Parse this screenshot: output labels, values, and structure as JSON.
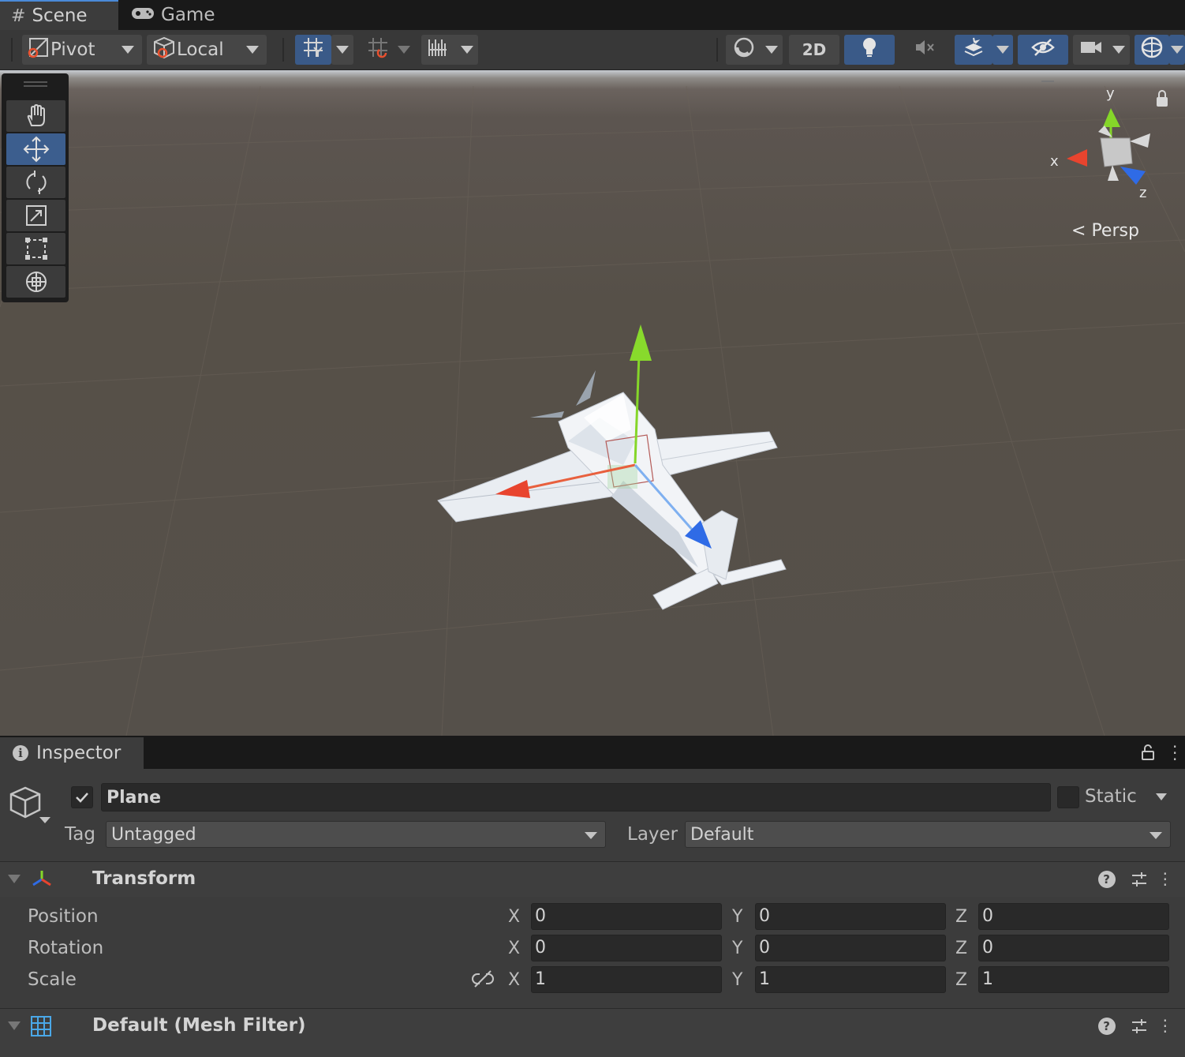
{
  "tabs": {
    "scene": "Scene",
    "game": "Game"
  },
  "toolbar": {
    "pivot_label": "Pivot",
    "local_label": "Local",
    "mode_2d_label": "2D",
    "icons": [
      "grid-snap-icon",
      "increment-snap-icon",
      "ruler-icon",
      "shading-mode-icon",
      "lighting-icon",
      "audio-mute-icon",
      "effects-icon",
      "hidden-objects-icon",
      "camera-icon",
      "gizmos-icon"
    ]
  },
  "scene": {
    "persp_label": "Persp",
    "gizmo_axes": {
      "x": "x",
      "y": "y",
      "z": "z"
    },
    "tools": [
      "hand-tool",
      "move-tool",
      "rotate-tool",
      "scale-tool",
      "rect-tool",
      "transform-tool"
    ],
    "active_tool": "move-tool"
  },
  "inspector": {
    "tab_label": "Inspector",
    "object_name": "Plane",
    "active": true,
    "static_label": "Static",
    "tag_label": "Tag",
    "tag_value": "Untagged",
    "layer_label": "Layer",
    "layer_value": "Default",
    "transform": {
      "title": "Transform",
      "position": {
        "label": "Position",
        "x": "0",
        "y": "0",
        "z": "0"
      },
      "rotation": {
        "label": "Rotation",
        "x": "0",
        "y": "0",
        "z": "0"
      },
      "scale": {
        "label": "Scale",
        "x": "1",
        "y": "1",
        "z": "1"
      },
      "axis_labels": {
        "x": "X",
        "y": "Y",
        "z": "Z"
      }
    },
    "mesh_filter": {
      "title": "Default (Mesh Filter)"
    }
  },
  "colors": {
    "accent": "#3a5a88",
    "x_axis": "#e8442e",
    "y_axis": "#85d629",
    "z_axis": "#2f6be6"
  }
}
